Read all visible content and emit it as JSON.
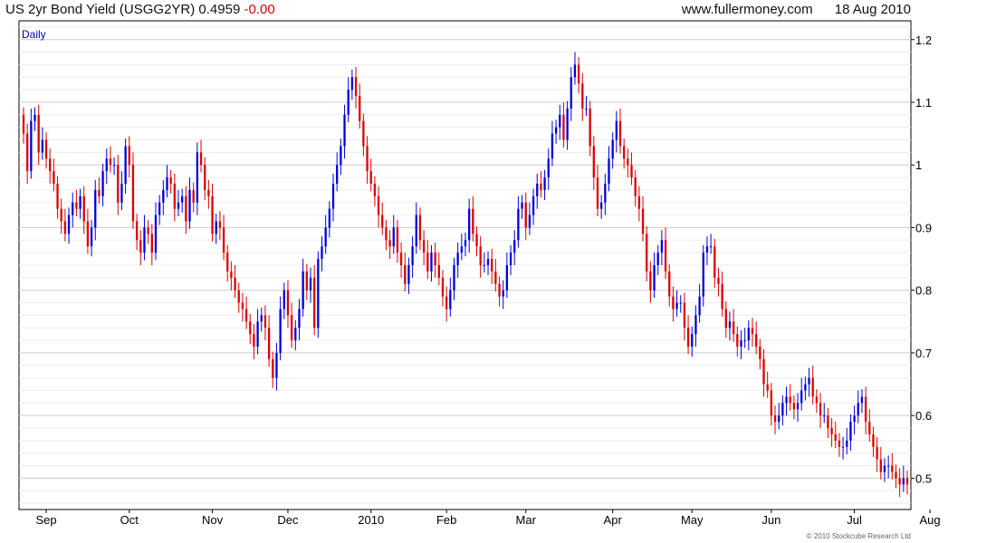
{
  "header": {
    "title": "US 2yr Bond Yield (USGG2YR)",
    "last_value": "0.4959",
    "change": "-0.00",
    "source": "www.fullermoney.com",
    "date": "18 Aug 2010"
  },
  "footer": {
    "copyright": "© 2010 Stockcube Research Ltd"
  },
  "colors": {
    "up": "#0000dd",
    "down": "#dd0000",
    "grid": "#cfcfcf",
    "axis": "#000000"
  },
  "chart_data": {
    "type": "candlestick",
    "period_label": "Daily",
    "y_axis": {
      "min": 0.45,
      "max": 1.23,
      "ticks": [
        0.5,
        0.6,
        0.7,
        0.8,
        0.9,
        1,
        1.1,
        1.2
      ],
      "tick_labels": [
        "0.5",
        "0.6",
        "0.7",
        "0.8",
        "0.9",
        "1",
        "1.1",
        "1.2"
      ],
      "position": "right"
    },
    "x_axis": {
      "labels": [
        "Sep",
        "Oct",
        "Nov",
        "Dec",
        "2010",
        "Feb",
        "Mar",
        "Apr",
        "May",
        "Jun",
        "Jul",
        "Aug"
      ],
      "label_index": [
        6,
        28,
        50,
        70,
        92,
        112,
        133,
        156,
        177,
        198,
        220,
        240
      ]
    },
    "grid": true,
    "legend": "none",
    "series": [
      {
        "close": [
          1.05,
          0.99,
          1.07,
          1.08,
          1.02,
          1.04,
          1.01,
          0.99,
          0.97,
          0.93,
          0.91,
          0.89,
          0.92,
          0.94,
          0.93,
          0.95,
          0.91,
          0.87,
          0.9,
          0.96,
          0.95,
          0.99,
          1.01,
          1.0,
          1.0,
          0.94,
          0.97,
          1.03,
          1.0,
          0.91,
          0.88,
          0.86,
          0.9,
          0.89,
          0.86,
          0.92,
          0.94,
          0.96,
          0.98,
          0.97,
          0.93,
          0.94,
          0.95,
          0.91,
          0.96,
          0.94,
          1.02,
          1.0,
          0.96,
          0.95,
          0.89,
          0.91,
          0.9,
          0.86,
          0.83,
          0.82,
          0.8,
          0.78,
          0.77,
          0.75,
          0.73,
          0.71,
          0.75,
          0.76,
          0.74,
          0.69,
          0.66,
          0.7,
          0.77,
          0.8,
          0.76,
          0.72,
          0.74,
          0.77,
          0.83,
          0.8,
          0.82,
          0.74,
          0.85,
          0.87,
          0.9,
          0.93,
          0.97,
          1.0,
          1.03,
          1.08,
          1.12,
          1.14,
          1.11,
          1.07,
          1.03,
          0.99,
          0.97,
          0.95,
          0.92,
          0.9,
          0.88,
          0.87,
          0.9,
          0.86,
          0.84,
          0.81,
          0.84,
          0.87,
          0.92,
          0.88,
          0.86,
          0.83,
          0.86,
          0.84,
          0.82,
          0.79,
          0.77,
          0.8,
          0.84,
          0.86,
          0.87,
          0.88,
          0.93,
          0.89,
          0.87,
          0.84,
          0.84,
          0.85,
          0.83,
          0.81,
          0.79,
          0.8,
          0.84,
          0.86,
          0.88,
          0.93,
          0.94,
          0.9,
          0.92,
          0.95,
          0.97,
          0.96,
          0.98,
          1.01,
          1.05,
          1.06,
          1.08,
          1.04,
          1.09,
          1.14,
          1.16,
          1.13,
          1.09,
          1.09,
          1.03,
          0.98,
          0.93,
          0.94,
          0.97,
          1.01,
          1.04,
          1.07,
          1.03,
          1.01,
          1.0,
          0.98,
          0.95,
          0.93,
          0.89,
          0.83,
          0.8,
          0.84,
          0.86,
          0.88,
          0.83,
          0.79,
          0.77,
          0.78,
          0.78,
          0.74,
          0.71,
          0.73,
          0.76,
          0.79,
          0.86,
          0.87,
          0.87,
          0.82,
          0.81,
          0.77,
          0.74,
          0.75,
          0.73,
          0.71,
          0.72,
          0.72,
          0.74,
          0.73,
          0.71,
          0.69,
          0.65,
          0.64,
          0.6,
          0.59,
          0.6,
          0.62,
          0.63,
          0.62,
          0.61,
          0.62,
          0.64,
          0.65,
          0.66,
          0.63,
          0.62,
          0.6,
          0.6,
          0.58,
          0.57,
          0.56,
          0.55,
          0.55,
          0.56,
          0.59,
          0.6,
          0.62,
          0.63,
          0.59,
          0.57,
          0.55,
          0.53,
          0.51,
          0.52,
          0.52,
          0.51,
          0.5,
          0.49,
          0.5,
          0.49
        ]
      }
    ]
  }
}
